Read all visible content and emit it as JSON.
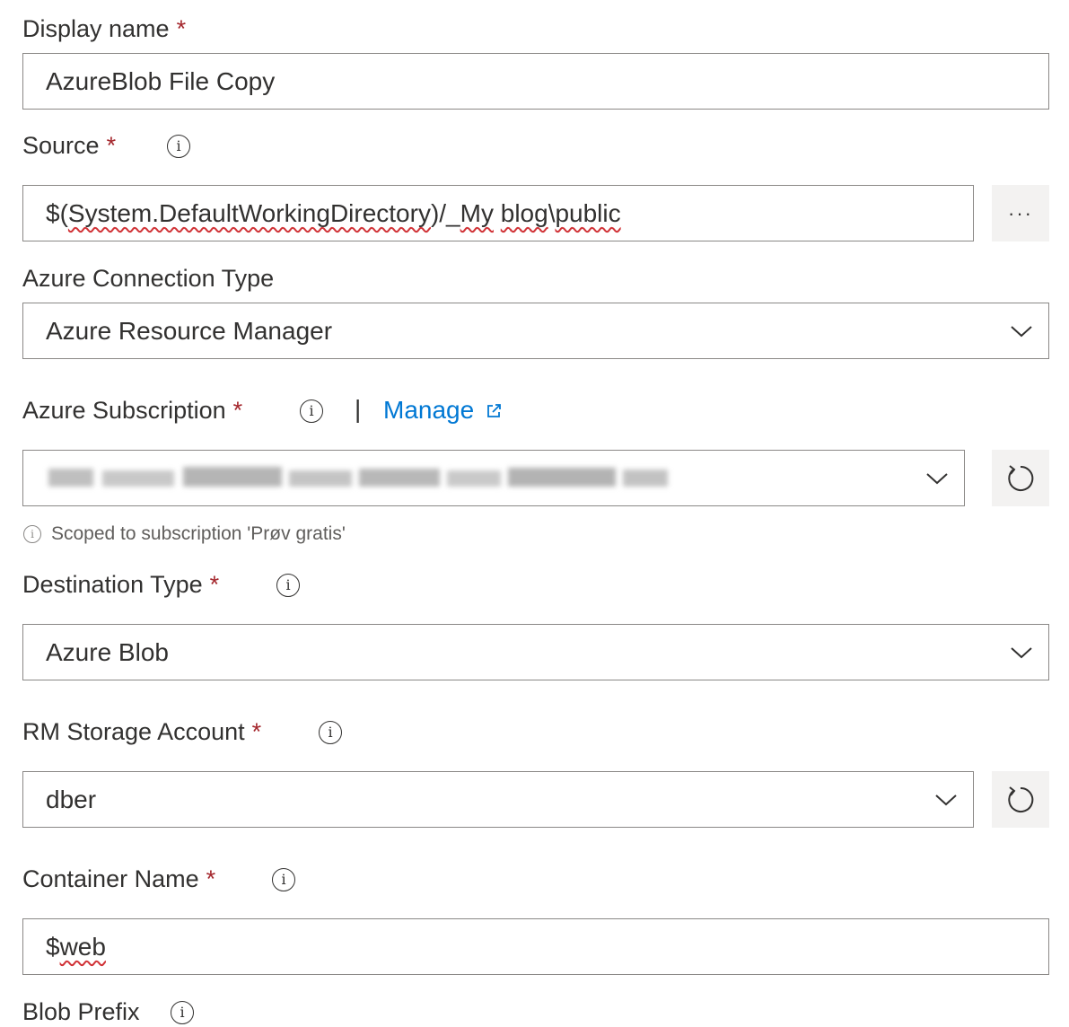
{
  "display_name": {
    "label": "Display name",
    "required_mark": "*",
    "value": "AzureBlob File Copy"
  },
  "source": {
    "label": "Source",
    "required_mark": "*",
    "info_icon": "info-icon",
    "value_parts": [
      "$(",
      "System.DefaultWorkingDirectory",
      ")/_",
      "My",
      " ",
      "blog",
      "\\",
      "public"
    ],
    "browse_label": "···"
  },
  "connection_type": {
    "label": "Azure Connection Type",
    "selected": "Azure Resource Manager"
  },
  "subscription": {
    "label": "Azure Subscription",
    "required_mark": "*",
    "separator": "|",
    "manage_label": "Manage",
    "selected_redacted": true,
    "hint": "Scoped to subscription 'Prøv gratis'"
  },
  "destination_type": {
    "label": "Destination Type",
    "required_mark": "*",
    "selected": "Azure Blob"
  },
  "storage_account": {
    "label": "RM Storage Account",
    "required_mark": "*",
    "selected": "dber"
  },
  "container_name": {
    "label": "Container Name",
    "required_mark": "*",
    "value_prefix": "$",
    "value_word": "web"
  },
  "blob_prefix": {
    "label": "Blob Prefix"
  },
  "colors": {
    "accent": "#0078d4",
    "required": "#a4262c",
    "border": "#8a8886",
    "button_bg": "#f3f2f1"
  }
}
